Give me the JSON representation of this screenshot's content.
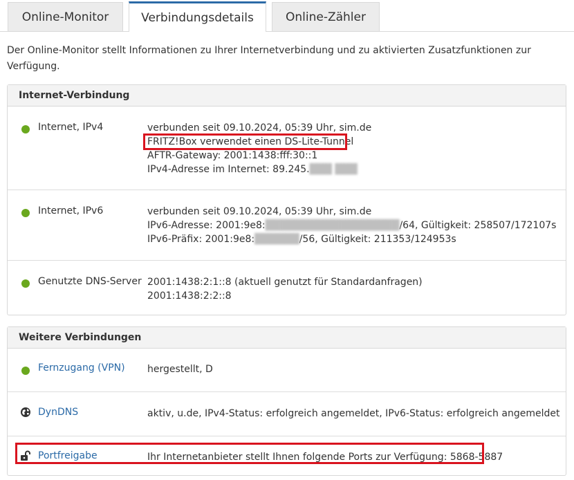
{
  "tabs": [
    {
      "label": "Online-Monitor"
    },
    {
      "label": "Verbindungsdetails"
    },
    {
      "label": "Online-Zähler"
    }
  ],
  "intro": "Der Online-Monitor stellt Informationen zu Ihrer Internetverbindung und zu aktivierten Zusatzfunktionen zur Verfügung.",
  "internet": {
    "title": "Internet-Verbindung",
    "rows": [
      {
        "label": "Internet, IPv4",
        "lines": {
          "connected": "verbunden seit 09.10.2024, 05:39 Uhr, sim.de",
          "tunnel": "FRITZ!Box verwendet einen DS-Lite-Tunnel",
          "gateway": "AFTR-Gateway: 2001:1438:fff:30::1",
          "ip_prefix": "IPv4-Adresse im Internet: 89.245."
        }
      },
      {
        "label": "Internet, IPv6",
        "lines": {
          "connected": "verbunden seit 09.10.2024, 05:39 Uhr, sim.de",
          "addr_pre": "IPv6-Adresse: 2001:9e8:",
          "addr_post": "/64, Gültigkeit: 258507/172107s",
          "prefix_pre": "IPv6-Präfix: 2001:9e8:",
          "prefix_post": "/56, Gültigkeit: 211353/124953s"
        }
      },
      {
        "label": "Genutzte DNS-Server",
        "lines": {
          "dns1": "2001:1438:2:1::8 (aktuell genutzt für Standardanfragen)",
          "dns2": "2001:1438:2:2::8"
        }
      }
    ]
  },
  "more": {
    "title": "Weitere Verbindungen",
    "rows": [
      {
        "label": "Fernzugang (VPN)",
        "value": "hergestellt, D"
      },
      {
        "label": "DynDNS",
        "value": "aktiv, u.de, IPv4-Status: erfolgreich angemeldet, IPv6-Status: erfolgreich angemeldet"
      },
      {
        "label": "Portfreigabe",
        "value": "Ihr Internetanbieter stellt Ihnen folgende Ports zur Verfügung: 5868-5887"
      }
    ]
  },
  "colors": {
    "accent": "#2b6aa7",
    "status_ok": "#6aa81e",
    "highlight": "#d9141f"
  }
}
